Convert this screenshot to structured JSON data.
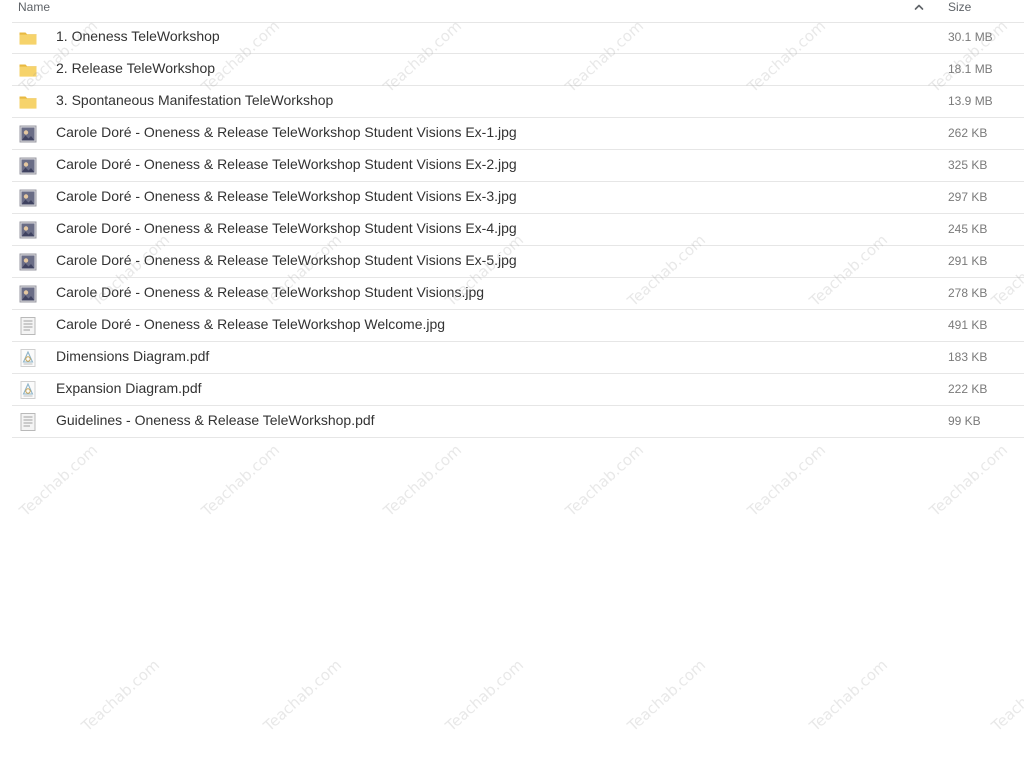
{
  "header": {
    "name_label": "Name",
    "size_label": "Size",
    "sort_icon": "chevron-up-icon"
  },
  "files": [
    {
      "name": "1. Oneness TeleWorkshop",
      "size": "30.1 MB",
      "icon": "folder-icon"
    },
    {
      "name": "2. Release TeleWorkshop",
      "size": "18.1 MB",
      "icon": "folder-icon"
    },
    {
      "name": "3. Spontaneous Manifestation TeleWorkshop",
      "size": "13.9 MB",
      "icon": "folder-icon"
    },
    {
      "name": "Carole Doré - Oneness & Release TeleWorkshop Student Visions Ex-1.jpg",
      "size": "262 KB",
      "icon": "image-thumbnail-icon"
    },
    {
      "name": "Carole Doré - Oneness & Release TeleWorkshop Student Visions Ex-2.jpg",
      "size": "325 KB",
      "icon": "image-thumbnail-icon"
    },
    {
      "name": "Carole Doré - Oneness & Release TeleWorkshop Student Visions Ex-3.jpg",
      "size": "297 KB",
      "icon": "image-thumbnail-icon"
    },
    {
      "name": "Carole Doré - Oneness & Release TeleWorkshop Student Visions Ex-4.jpg",
      "size": "245 KB",
      "icon": "image-thumbnail-icon"
    },
    {
      "name": "Carole Doré - Oneness & Release TeleWorkshop Student Visions Ex-5.jpg",
      "size": "291 KB",
      "icon": "image-thumbnail-icon"
    },
    {
      "name": "Carole Doré - Oneness & Release TeleWorkshop Student Visions.jpg",
      "size": "278 KB",
      "icon": "image-thumbnail-icon"
    },
    {
      "name": "Carole Doré - Oneness & Release TeleWorkshop Welcome.jpg",
      "size": "491 KB",
      "icon": "document-thumbnail-icon"
    },
    {
      "name": "Dimensions Diagram.pdf",
      "size": "183 KB",
      "icon": "pdf-thumbnail-icon"
    },
    {
      "name": "Expansion Diagram.pdf",
      "size": "222 KB",
      "icon": "pdf-thumbnail-icon"
    },
    {
      "name": "Guidelines - Oneness & Release TeleWorkshop.pdf",
      "size": "99 KB",
      "icon": "document-thumbnail-icon"
    }
  ],
  "watermark_text": "Teachab.com",
  "colors": {
    "folder": "#f6d36b",
    "folder_tab": "#e8b941",
    "divider": "#e6e6e6",
    "name_text": "#333333",
    "size_text": "#7a7a7a"
  }
}
